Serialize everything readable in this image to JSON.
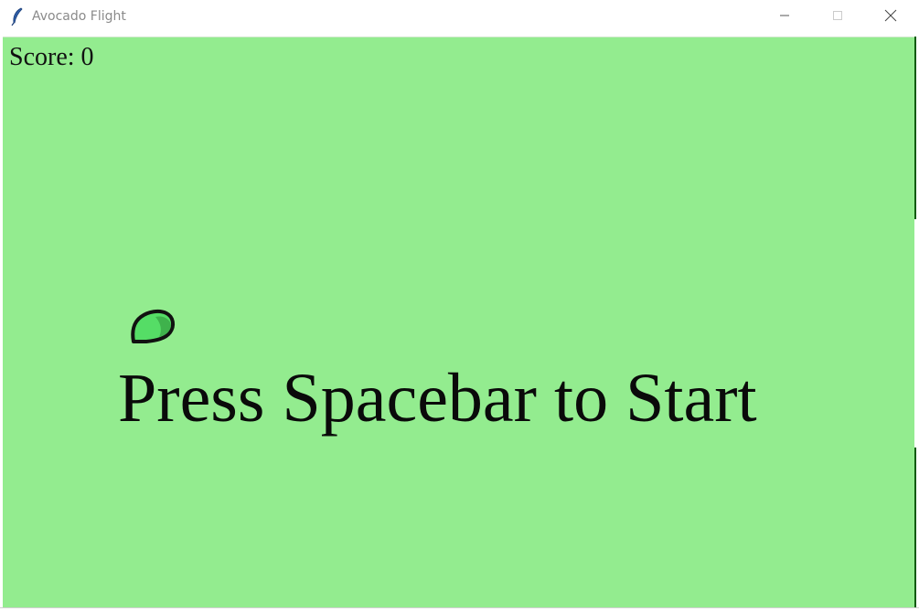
{
  "window": {
    "title": "Avocado Flight",
    "icon": "feather-icon",
    "controls": [
      "minimize-icon",
      "maximize-icon",
      "close-icon"
    ]
  },
  "game": {
    "score_text": "Score: 0",
    "start_message": "Press Spacebar to Start",
    "background_color": "#93ec8f",
    "pipe_color": "#0a5a0a",
    "avocado_colors": {
      "outline": "#111111",
      "flesh_light": "#55dd66",
      "flesh_dark": "#3caa48"
    }
  }
}
